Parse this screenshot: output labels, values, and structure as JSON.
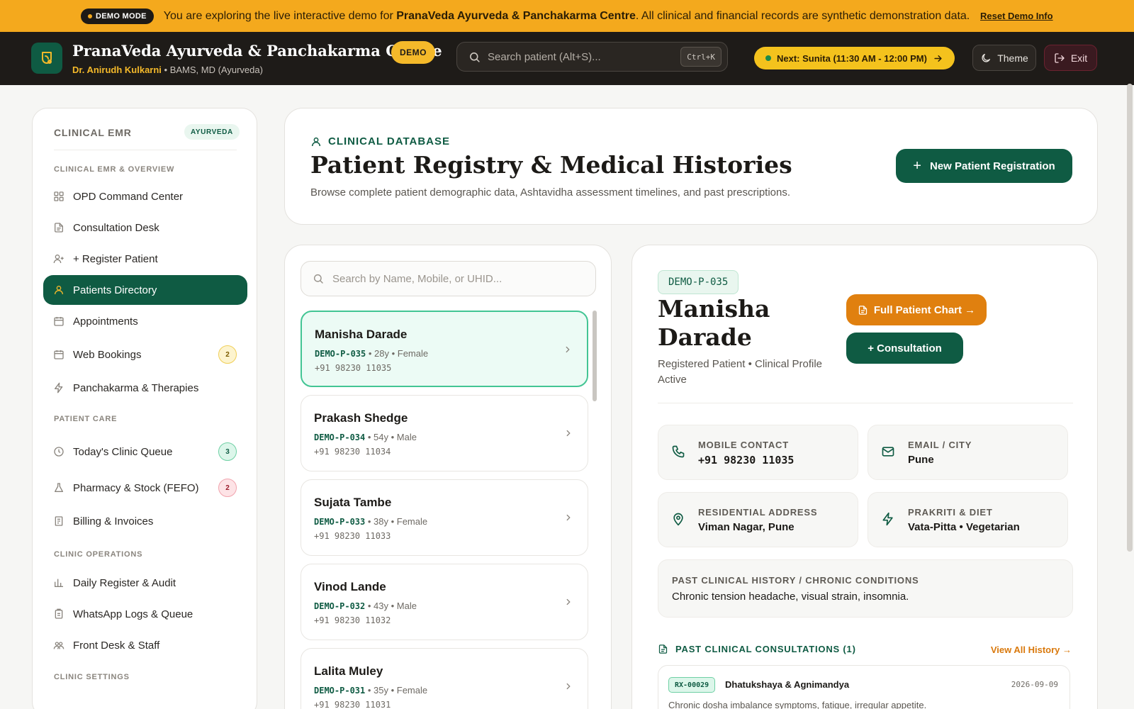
{
  "banner": {
    "mode_label": "DEMO MODE",
    "text_prefix": "You are exploring the live interactive demo for ",
    "clinic_bold": "PranaVeda Ayurveda & Panchakarma Centre",
    "text_suffix": ". All clinical and financial records are synthetic demonstration data.",
    "reset_link": "Reset Demo Info"
  },
  "header": {
    "clinic_name": "PranaVeda Ayurveda & Panchakarma Centre",
    "demo_badge": "DEMO",
    "doctor_name": "Dr. Anirudh Kulkarni",
    "doctor_sep": " • ",
    "doctor_degree": "BAMS, MD (Ayurveda)",
    "search_placeholder": "Search patient (Alt+S)...",
    "search_shortcut": "Ctrl+K",
    "next_label": "Next: ",
    "next_value": "Sunita (11:30 AM - 12:00 PM)",
    "theme_label": "Theme",
    "exit_label": "Exit"
  },
  "sidebar": {
    "heading": "CLINICAL EMR",
    "tag": "AYURVEDA",
    "sections": [
      {
        "title": "CLINICAL EMR & OVERVIEW"
      },
      {
        "title": "PATIENT CARE"
      },
      {
        "title": "CLINIC OPERATIONS"
      },
      {
        "title": "CLINIC SETTINGS"
      }
    ],
    "items": [
      {
        "label": "OPD Command Center"
      },
      {
        "label": "Consultation Desk"
      },
      {
        "label": "+ Register Patient"
      },
      {
        "label": "Patients Directory"
      },
      {
        "label": "Appointments"
      },
      {
        "label": "Web Bookings",
        "badge": "2"
      },
      {
        "label": "Panchakarma & Therapies"
      },
      {
        "label": "Today's Clinic Queue",
        "badge": "3"
      },
      {
        "label": "Pharmacy & Stock (FEFO)",
        "badge": "2"
      },
      {
        "label": "Billing & Invoices"
      },
      {
        "label": "Daily Register & Audit"
      },
      {
        "label": "WhatsApp Logs & Queue"
      },
      {
        "label": "Front Desk & Staff"
      }
    ]
  },
  "main": {
    "eyebrow": "CLINICAL DATABASE",
    "title": "Patient Registry & Medical Histories",
    "subtitle": "Browse complete patient demographic data, Ashtavidha assessment timelines, and past prescriptions.",
    "new_patient_label": "New Patient Registration"
  },
  "list": {
    "search_placeholder": "Search by Name, Mobile, or UHID...",
    "patients": [
      {
        "name": "Manisha Darade",
        "id": "DEMO-P-035",
        "info": " • 28y • Female",
        "phone": "+91 98230 11035"
      },
      {
        "name": "Prakash Shedge",
        "id": "DEMO-P-034",
        "info": " • 54y • Male",
        "phone": "+91 98230 11034"
      },
      {
        "name": "Sujata Tambe",
        "id": "DEMO-P-033",
        "info": " • 38y • Female",
        "phone": "+91 98230 11033"
      },
      {
        "name": "Vinod Lande",
        "id": "DEMO-P-032",
        "info": " • 43y • Male",
        "phone": "+91 98230 11032"
      },
      {
        "name": "Lalita Muley",
        "id": "DEMO-P-031",
        "info": " • 35y • Female",
        "phone": "+91 98230 11031"
      }
    ]
  },
  "detail": {
    "uhid": "DEMO-P-035",
    "first_name": "Manisha",
    "last_name": "Darade",
    "status": "Registered Patient • Clinical Profile Active",
    "full_chart_label": "Full Patient Chart →",
    "consult_label": "+ Consultation",
    "mobile": {
      "label": "MOBILE CONTACT",
      "value": "+91 98230 11035"
    },
    "email": {
      "label": "EMAIL / CITY",
      "value": "Pune"
    },
    "address": {
      "label": "RESIDENTIAL ADDRESS",
      "value": "Viman Nagar, Pune"
    },
    "prakriti": {
      "label": "PRAKRITI & DIET",
      "value": "Vata-Pitta • Vegetarian"
    },
    "history": {
      "label": "PAST CLINICAL HISTORY / CHRONIC CONDITIONS",
      "value": "Chronic tension headache, visual strain, insomnia."
    },
    "past_heading": "PAST CLINICAL CONSULTATIONS (1)",
    "view_all": "View All History →",
    "consultations": [
      {
        "rx": "RX-00029",
        "title": "Dhatukshaya & Agnimandya",
        "date": "2026-09-09",
        "desc": "Chronic dosha imbalance symptoms, fatigue, irregular appetite."
      }
    ]
  }
}
